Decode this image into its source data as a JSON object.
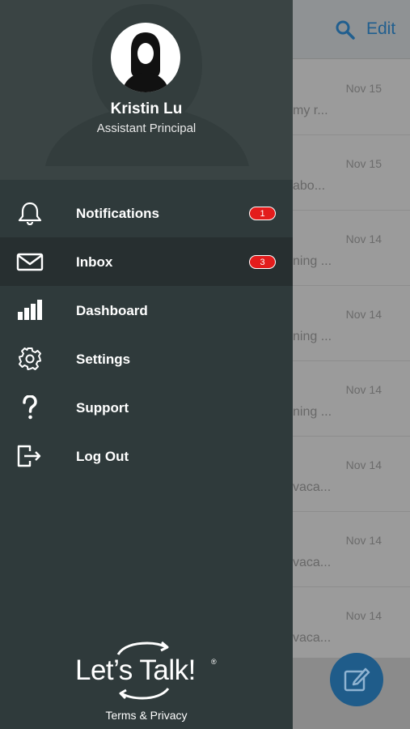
{
  "background": {
    "header": {
      "edit_label": "Edit",
      "search_icon": "search-icon"
    },
    "messages": [
      {
        "date": "Nov 15",
        "snippet": "my r..."
      },
      {
        "date": "Nov 15",
        "snippet": "abo..."
      },
      {
        "date": "Nov 14",
        "snippet": "ning ..."
      },
      {
        "date": "Nov 14",
        "snippet": "ning ..."
      },
      {
        "date": "Nov 14",
        "snippet": "ning ..."
      },
      {
        "date": "Nov 14",
        "snippet": "vaca..."
      },
      {
        "date": "Nov 14",
        "snippet": "vaca..."
      },
      {
        "date": "Nov 14",
        "snippet": "vaca..."
      }
    ],
    "compose_icon": "compose-icon"
  },
  "drawer": {
    "profile": {
      "name": "Kristin Lu",
      "role": "Assistant Principal"
    },
    "menu": [
      {
        "label": "Notifications",
        "icon": "bell-icon",
        "badge": "1"
      },
      {
        "label": "Inbox",
        "icon": "envelope-icon",
        "badge": "3",
        "active": true
      },
      {
        "label": "Dashboard",
        "icon": "bar-chart-icon"
      },
      {
        "label": "Settings",
        "icon": "gear-icon"
      },
      {
        "label": "Support",
        "icon": "question-icon"
      },
      {
        "label": "Log Out",
        "icon": "logout-icon"
      }
    ],
    "logo_text": "Let’s Talk!",
    "logo_reg": "®",
    "terms_label": "Terms & Privacy"
  },
  "colors": {
    "drawer_bg": "#2f3a3b",
    "badge": "#e31c1c",
    "accent": "#1f5c8a"
  }
}
